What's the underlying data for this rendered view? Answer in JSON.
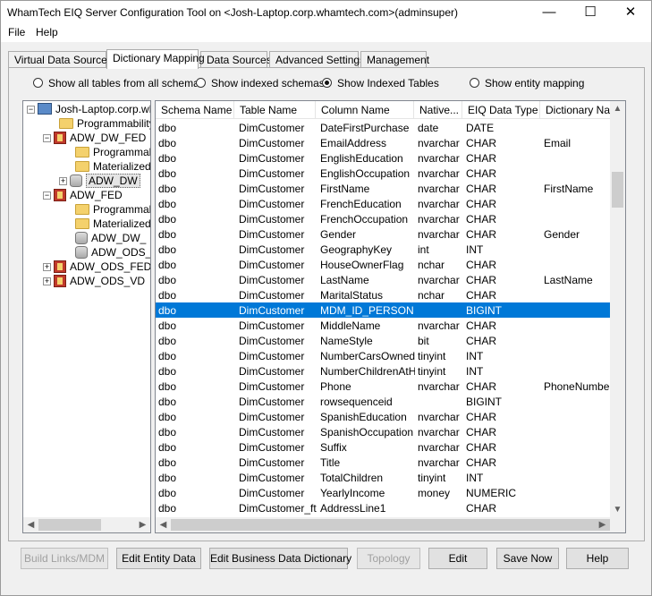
{
  "window": {
    "title": "WhamTech EIQ Server Configuration Tool on <Josh-Laptop.corp.whamtech.com>(adminsuper)"
  },
  "window_controls": {
    "minimize": "—",
    "maximize": "☐",
    "close": "✕"
  },
  "menu": [
    "File",
    "Help"
  ],
  "tabs": [
    "Virtual Data Sources",
    "Dictionary Mapping",
    "Data Sources",
    "Advanced Settings",
    "Management"
  ],
  "active_tab": "Dictionary Mapping",
  "radios": [
    {
      "label": "Show all tables from all schemas",
      "selected": false
    },
    {
      "label": "Show indexed schemas",
      "selected": false
    },
    {
      "label": "Show Indexed Tables",
      "selected": true
    },
    {
      "label": "Show entity mapping",
      "selected": false
    }
  ],
  "tree": [
    {
      "label": "Josh-Laptop.corp.wh",
      "icon": "server-icon",
      "expander": "−"
    },
    {
      "label": "Programmability",
      "icon": "folder-icon",
      "expander": ""
    },
    {
      "label": "ADW_DW_FED",
      "icon": "federation-icon",
      "expander": "−"
    },
    {
      "label": "Programmab",
      "icon": "folder-icon",
      "expander": ""
    },
    {
      "label": "Materialized",
      "icon": "folder-icon",
      "expander": ""
    },
    {
      "label": "ADW_DW",
      "icon": "database-icon",
      "expander": "+"
    },
    {
      "label": "ADW_FED",
      "icon": "federation-icon",
      "expander": "−"
    },
    {
      "label": "Programmab",
      "icon": "folder-icon",
      "expander": ""
    },
    {
      "label": "Materialized",
      "icon": "folder-icon",
      "expander": ""
    },
    {
      "label": "ADW_DW_",
      "icon": "database-icon",
      "expander": ""
    },
    {
      "label": "ADW_ODS_",
      "icon": "database-icon",
      "expander": ""
    },
    {
      "label": "ADW_ODS_FED",
      "icon": "federation-icon",
      "expander": "+"
    },
    {
      "label": "ADW_ODS_VD",
      "icon": "federation-icon",
      "expander": "+"
    }
  ],
  "grid": {
    "headers": [
      "Schema Name",
      "Table Name",
      "Column Name",
      "Native...",
      "EIQ Data Type",
      "Dictionary Nam"
    ],
    "rows": [
      [
        "dbo",
        "DimCustomer",
        "DateFirstPurchase",
        "date",
        "DATE",
        ""
      ],
      [
        "dbo",
        "DimCustomer",
        "EmailAddress",
        "nvarchar",
        "CHAR",
        "Email"
      ],
      [
        "dbo",
        "DimCustomer",
        "EnglishEducation",
        "nvarchar",
        "CHAR",
        ""
      ],
      [
        "dbo",
        "DimCustomer",
        "EnglishOccupation",
        "nvarchar",
        "CHAR",
        ""
      ],
      [
        "dbo",
        "DimCustomer",
        "FirstName",
        "nvarchar",
        "CHAR",
        "FirstName"
      ],
      [
        "dbo",
        "DimCustomer",
        "FrenchEducation",
        "nvarchar",
        "CHAR",
        ""
      ],
      [
        "dbo",
        "DimCustomer",
        "FrenchOccupation",
        "nvarchar",
        "CHAR",
        ""
      ],
      [
        "dbo",
        "DimCustomer",
        "Gender",
        "nvarchar",
        "CHAR",
        "Gender"
      ],
      [
        "dbo",
        "DimCustomer",
        "GeographyKey",
        "int",
        "INT",
        ""
      ],
      [
        "dbo",
        "DimCustomer",
        "HouseOwnerFlag",
        "nchar",
        "CHAR",
        ""
      ],
      [
        "dbo",
        "DimCustomer",
        "LastName",
        "nvarchar",
        "CHAR",
        "LastName"
      ],
      [
        "dbo",
        "DimCustomer",
        "MaritalStatus",
        "nchar",
        "CHAR",
        ""
      ],
      [
        "dbo",
        "DimCustomer",
        "MDM_ID_PERSON",
        "",
        "BIGINT",
        ""
      ],
      [
        "dbo",
        "DimCustomer",
        "MiddleName",
        "nvarchar",
        "CHAR",
        ""
      ],
      [
        "dbo",
        "DimCustomer",
        "NameStyle",
        "bit",
        "CHAR",
        ""
      ],
      [
        "dbo",
        "DimCustomer",
        "NumberCarsOwned",
        "tinyint",
        "INT",
        ""
      ],
      [
        "dbo",
        "DimCustomer",
        "NumberChildrenAtH...",
        "tinyint",
        "INT",
        ""
      ],
      [
        "dbo",
        "DimCustomer",
        "Phone",
        "nvarchar",
        "CHAR",
        "PhoneNumber"
      ],
      [
        "dbo",
        "DimCustomer",
        "rowsequenceid",
        "",
        "BIGINT",
        ""
      ],
      [
        "dbo",
        "DimCustomer",
        "SpanishEducation",
        "nvarchar",
        "CHAR",
        ""
      ],
      [
        "dbo",
        "DimCustomer",
        "SpanishOccupation",
        "nvarchar",
        "CHAR",
        ""
      ],
      [
        "dbo",
        "DimCustomer",
        "Suffix",
        "nvarchar",
        "CHAR",
        ""
      ],
      [
        "dbo",
        "DimCustomer",
        "Title",
        "nvarchar",
        "CHAR",
        ""
      ],
      [
        "dbo",
        "DimCustomer",
        "TotalChildren",
        "tinyint",
        "INT",
        ""
      ],
      [
        "dbo",
        "DimCustomer",
        "YearlyIncome",
        "money",
        "NUMERIC",
        ""
      ],
      [
        "dbo",
        "DimCustomer_ft",
        "AddressLine1",
        "",
        "CHAR",
        ""
      ]
    ],
    "selected_row": 12
  },
  "buttons": [
    {
      "label": "Build Links/MDM",
      "enabled": false
    },
    {
      "label": "Edit Entity Data",
      "enabled": true
    },
    {
      "label": "Edit Business Data Dictionary",
      "enabled": true
    },
    {
      "label": "Topology",
      "enabled": false
    },
    {
      "label": "Edit",
      "enabled": true
    },
    {
      "label": "Save Now",
      "enabled": true
    },
    {
      "label": "Help",
      "enabled": true
    }
  ],
  "colors": {
    "selection": "#0078d7",
    "window_bg": "#f0f0f0"
  }
}
